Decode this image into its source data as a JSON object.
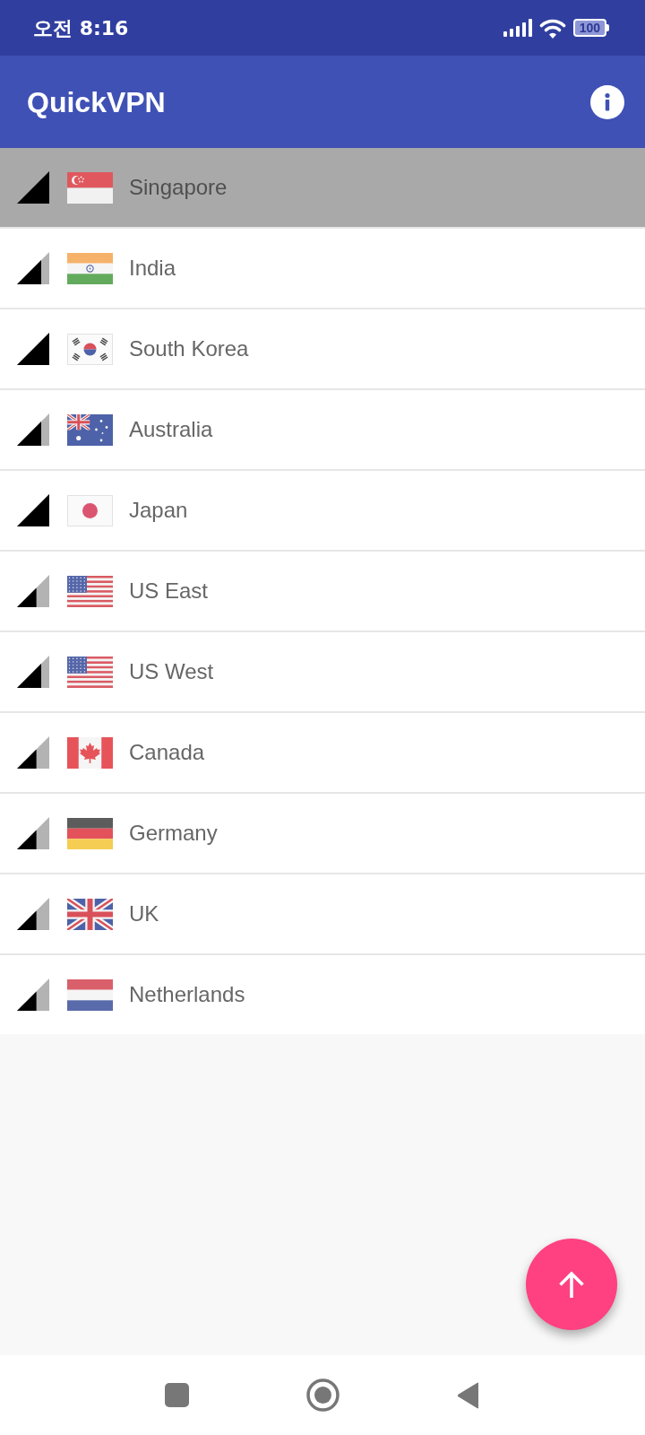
{
  "status_bar": {
    "time": "오전 8:16",
    "battery": "100"
  },
  "app_bar": {
    "title": "QuickVPN"
  },
  "servers": [
    {
      "name": "Singapore",
      "kind": "sg",
      "level": 1,
      "selected": true
    },
    {
      "name": "India",
      "kind": "in",
      "level": 0.75,
      "selected": false
    },
    {
      "name": "South Korea",
      "kind": "kr",
      "level": 1,
      "selected": false
    },
    {
      "name": "Australia",
      "kind": "au",
      "level": 0.75,
      "selected": false
    },
    {
      "name": "Japan",
      "kind": "jp",
      "level": 1,
      "selected": false
    },
    {
      "name": "US East",
      "kind": "us",
      "level": 0.6,
      "selected": false
    },
    {
      "name": "US West",
      "kind": "us",
      "level": 0.75,
      "selected": false
    },
    {
      "name": "Canada",
      "kind": "ca",
      "level": 0.6,
      "selected": false
    },
    {
      "name": "Germany",
      "kind": "de",
      "level": 0.6,
      "selected": false
    },
    {
      "name": "UK",
      "kind": "gb",
      "level": 0.6,
      "selected": false
    },
    {
      "name": "Netherlands",
      "kind": "nl",
      "level": 0.6,
      "selected": false
    }
  ]
}
